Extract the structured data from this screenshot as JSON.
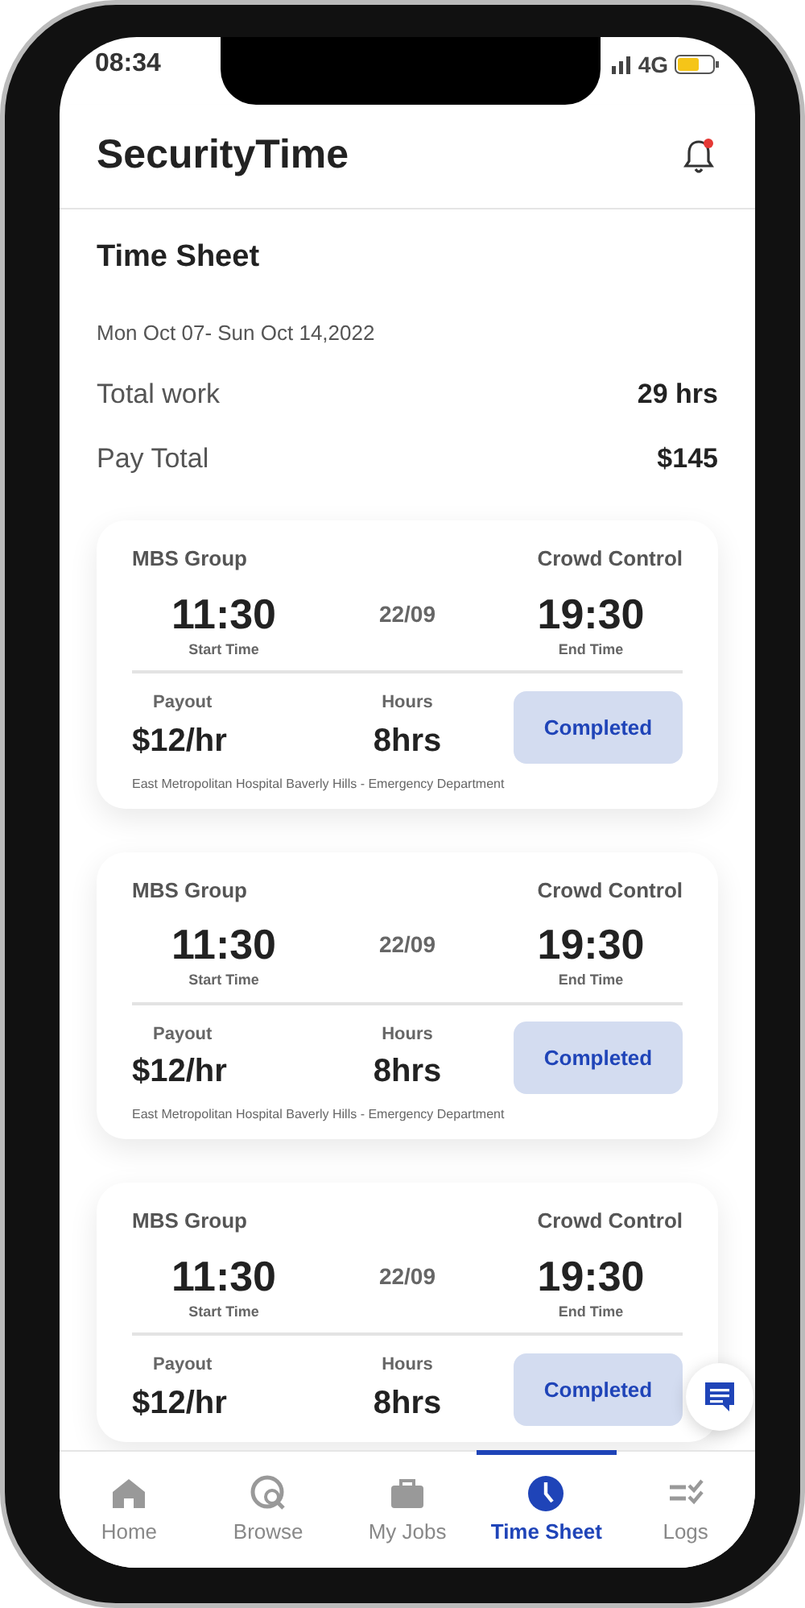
{
  "status_bar": {
    "time": "08:34",
    "network": "4G"
  },
  "header": {
    "title": "SecurityTime",
    "has_notification": true
  },
  "summary": {
    "title": "Time Sheet",
    "date_range": "Mon Oct 07- Sun Oct 14,2022",
    "rows": [
      {
        "label": "Total work",
        "value": "29 hrs"
      },
      {
        "label": "Pay Total",
        "value": "$145"
      }
    ]
  },
  "shifts": [
    {
      "company": "MBS Group",
      "category": "Crowd Control",
      "start": "11:30",
      "start_label": "Start Time",
      "date": "22/09",
      "end": "19:30",
      "end_label": "End Time",
      "payout_label": "Payout",
      "payout": "$12/hr",
      "hours_label": "Hours",
      "hours": "8hrs",
      "status": "Completed",
      "address": "East Metropolitan Hospital Baverly Hills - Emergency Department"
    },
    {
      "company": "MBS Group",
      "category": "Crowd Control",
      "start": "11:30",
      "start_label": "Start Time",
      "date": "22/09",
      "end": "19:30",
      "end_label": "End Time",
      "payout_label": "Payout",
      "payout": "$12/hr",
      "hours_label": "Hours",
      "hours": "8hrs",
      "status": "Completed",
      "address": "East Metropolitan Hospital Baverly Hills - Emergency Department"
    },
    {
      "company": "MBS Group",
      "category": "Crowd Control",
      "start": "11:30",
      "start_label": "Start Time",
      "date": "22/09",
      "end": "19:30",
      "end_label": "End Time",
      "payout_label": "Payout",
      "payout": "$12/hr",
      "hours_label": "Hours",
      "hours": "8hrs",
      "status": "Completed"
    }
  ],
  "bottom_nav": [
    {
      "label": "Home",
      "kind": "home",
      "selected": false
    },
    {
      "label": "Browse",
      "kind": "browse",
      "selected": false
    },
    {
      "label": "My Jobs",
      "kind": "jobs",
      "selected": false
    },
    {
      "label": "Time Sheet",
      "kind": "clock",
      "selected": true
    },
    {
      "label": "Logs",
      "kind": "logs",
      "selected": false
    }
  ]
}
